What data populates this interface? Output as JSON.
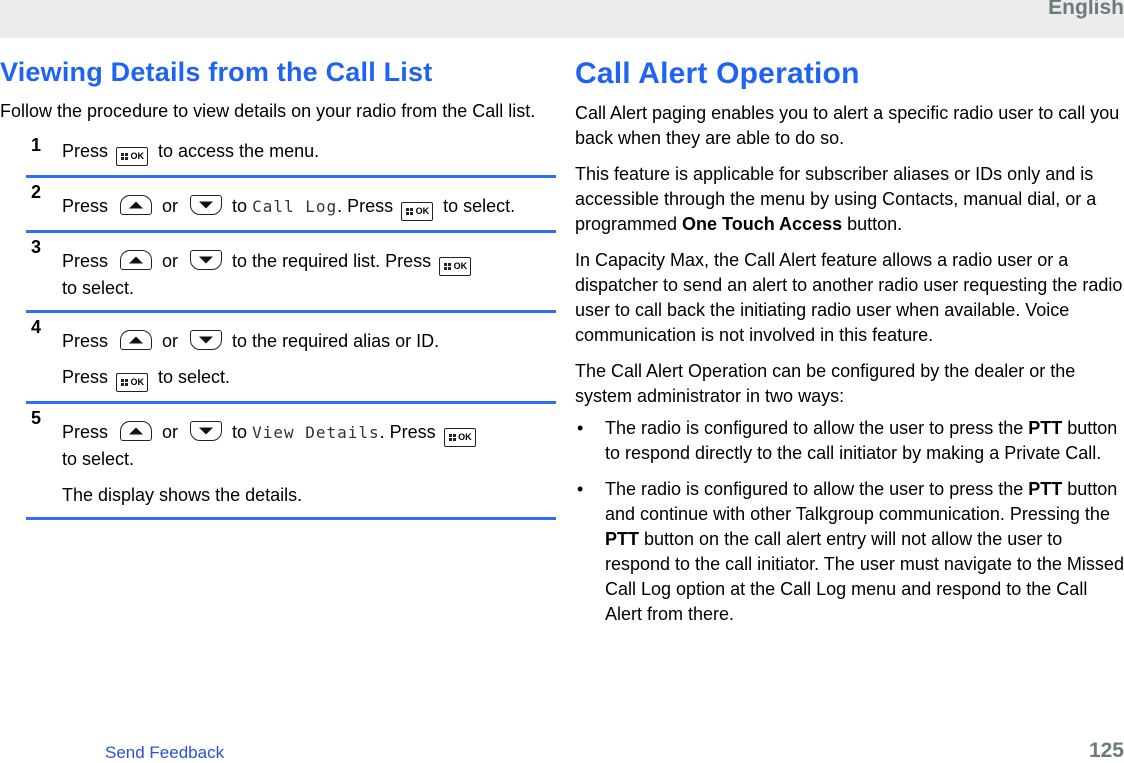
{
  "header": {
    "language": "English"
  },
  "left": {
    "title": "Viewing Details from the Call List",
    "intro": "Follow the procedure to view details on your radio from the Call list.",
    "steps": [
      {
        "num": "1",
        "parts": [
          "Press",
          "to access the menu."
        ]
      },
      {
        "num": "2",
        "parts": [
          "Press",
          "or",
          "to",
          "Call Log",
          ". Press",
          "to select."
        ]
      },
      {
        "num": "3",
        "parts": [
          "Press",
          "or",
          "to the required list. Press",
          "to select."
        ]
      },
      {
        "num": "4",
        "parts": [
          "Press",
          "or",
          "to the required alias or ID.",
          "Press",
          "to select."
        ]
      },
      {
        "num": "5",
        "parts": [
          "Press",
          "or",
          "to",
          "View Details",
          ". Press",
          "to select.",
          "The display shows the details."
        ]
      }
    ],
    "icons": {
      "ok_key": "menu-ok-button-icon",
      "ok_label": "OK",
      "up_key": "navigation-up-icon",
      "down_key": "navigation-down-icon"
    }
  },
  "right": {
    "title": "Call Alert Operation",
    "p1": "Call Alert paging enables you to alert a specific radio user to call you back when they are able to do so.",
    "p2_a": "This feature is applicable for subscriber aliases or IDs only and is accessible through the menu by using Contacts, manual dial, or a programmed ",
    "p2_bold": "One Touch Access",
    "p2_b": " button.",
    "p3": "In Capacity Max, the Call Alert feature allows a radio user or a dispatcher to send an alert to another radio user requesting the radio user to call back the initiating radio user when available. Voice communication is not involved in this feature.",
    "p4": "The Call Alert Operation can be configured by the dealer or the system administrator in two ways:",
    "bullet": "•",
    "bullets": [
      {
        "a": "The radio is configured to allow the user to press the ",
        "bold": "PTT",
        "b": " button to respond directly to the call initiator by making a Private Call."
      },
      {
        "a": "The radio is configured to allow the user to press the ",
        "bold": "PTT",
        "b": " button and continue with other Talkgroup communication. Pressing the ",
        "bold2": "PTT",
        "c": " button on the call alert entry will not allow the user to respond to the call initiator. The user must navigate to the Missed Call Log option at the Call Log menu and respond to the Call Alert from there."
      }
    ]
  },
  "footer": {
    "feedback_link": "Send Feedback",
    "page_number": "125"
  }
}
